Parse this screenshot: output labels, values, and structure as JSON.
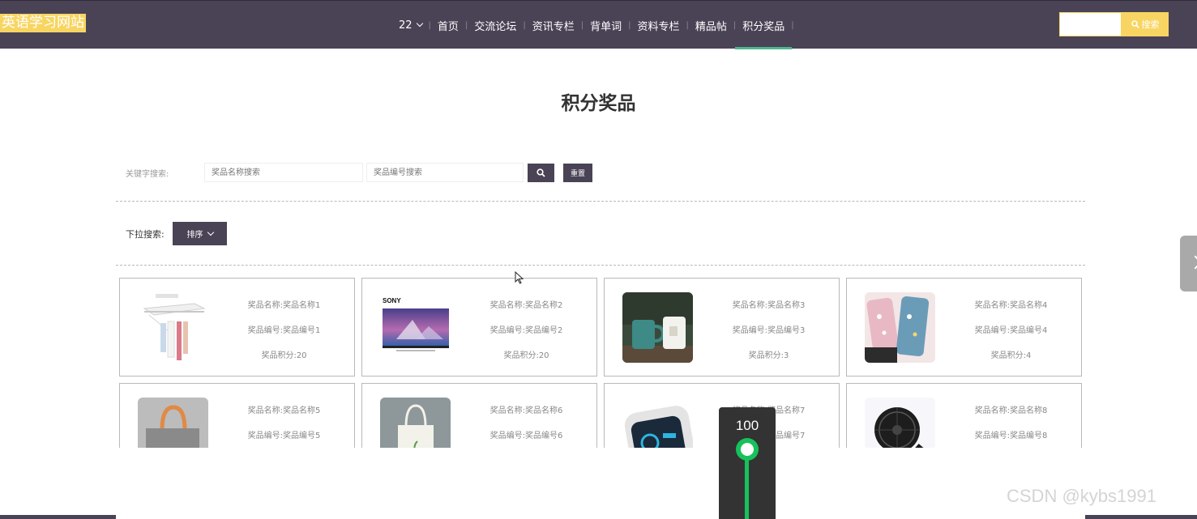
{
  "header": {
    "logo": "英语学习网站",
    "user": "22",
    "nav": [
      "首页",
      "交流论坛",
      "资讯专栏",
      "背单词",
      "资料专栏",
      "精品帖",
      "积分奖品"
    ],
    "search_placeholder": "",
    "search_label": "搜索"
  },
  "page": {
    "title": "积分奖品",
    "keyword_label": "关键字搜索:",
    "name_placeholder": "奖品名称搜索",
    "code_placeholder": "奖品编号搜索",
    "reset_label": "重置",
    "dropdown_label": "下拉搜索:",
    "sort_label": "排序"
  },
  "prizes": [
    {
      "name": "奖品名称:奖品名称1",
      "code": "奖品编号:奖品编号1",
      "points": "奖品积分:20",
      "image": "drying-rack"
    },
    {
      "name": "奖品名称:奖品名称2",
      "code": "奖品编号:奖品编号2",
      "points": "奖品积分:20",
      "image": "sony-tv",
      "brand": "SONY"
    },
    {
      "name": "奖品名称:奖品名称3",
      "code": "奖品编号:奖品编号3",
      "points": "奖品积分:3",
      "image": "mugs"
    },
    {
      "name": "奖品名称:奖品名称4",
      "code": "奖品编号:奖品编号4",
      "points": "奖品积分:4",
      "image": "phone-case"
    },
    {
      "name": "奖品名称:奖品名称5",
      "code": "奖品编号:奖品编号5",
      "points": "",
      "image": "felt-bag"
    },
    {
      "name": "奖品名称:奖品名称6",
      "code": "奖品编号:奖品编号6",
      "points": "",
      "image": "tote-bag"
    },
    {
      "name": "奖品名称:奖品名称7",
      "code": "奖品编号:奖品编号7",
      "points": "",
      "image": "smart-device"
    },
    {
      "name": "奖品名称:奖品名称8",
      "code": "奖品编号:奖品编号8",
      "points": "",
      "image": "desk-fan"
    }
  ],
  "zoom": {
    "value": "100"
  },
  "watermark": "CSDN @kybs1991",
  "colors": {
    "header_bg": "#4a4356",
    "accent_yellow": "#f8d562",
    "active_underline": "#4fb68f",
    "zoom_green": "#16c25b"
  }
}
